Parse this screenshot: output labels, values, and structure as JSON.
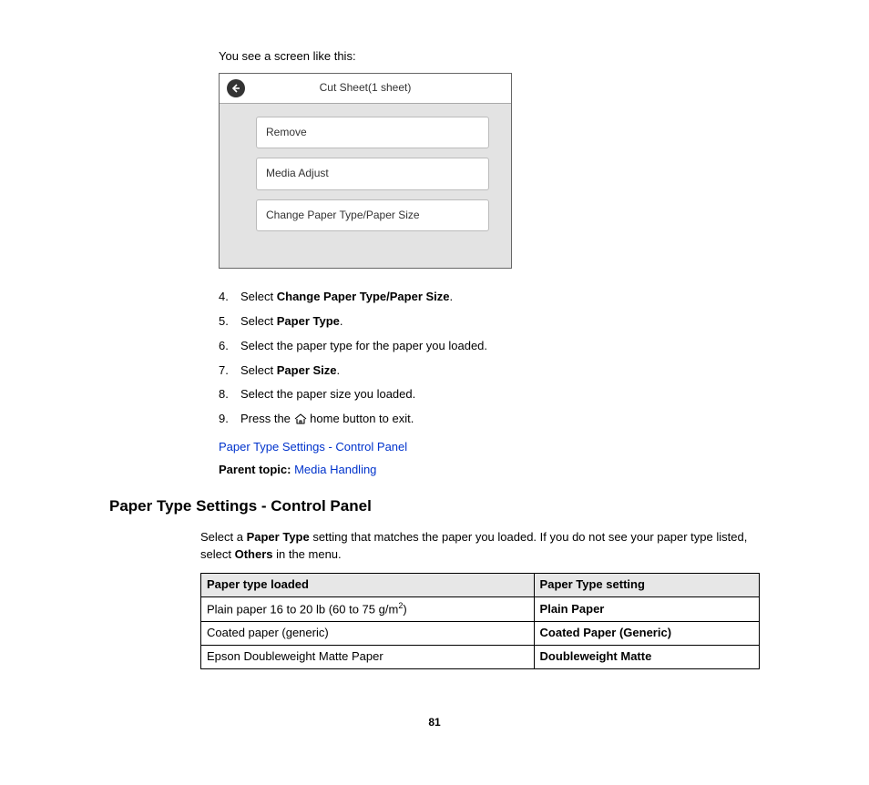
{
  "intro": "You see a screen like this:",
  "panel": {
    "title": "Cut Sheet(1 sheet)",
    "items": [
      "Remove",
      "Media Adjust",
      "Change Paper Type/Paper Size"
    ]
  },
  "steps": {
    "s4": {
      "num": "4.",
      "pre": "Select ",
      "bold": "Change Paper Type/Paper Size",
      "post": "."
    },
    "s5": {
      "num": "5.",
      "pre": "Select ",
      "bold": "Paper Type",
      "post": "."
    },
    "s6": {
      "num": "6.",
      "text": "Select the paper type for the paper you loaded."
    },
    "s7": {
      "num": "7.",
      "pre": "Select ",
      "bold": "Paper Size",
      "post": "."
    },
    "s8": {
      "num": "8.",
      "text": "Select the paper size you loaded."
    },
    "s9": {
      "num": "9.",
      "pre": "Press the ",
      "post": " home button to exit."
    }
  },
  "link1": "Paper Type Settings - Control Panel",
  "parent_label": "Parent topic: ",
  "parent_link": "Media Handling",
  "heading": "Paper Type Settings - Control Panel",
  "sect_desc_pre": "Select a ",
  "sect_desc_bold1": "Paper Type",
  "sect_desc_mid": " setting that matches the paper you loaded. If you do not see your paper type listed, select ",
  "sect_desc_bold2": "Others",
  "sect_desc_post": " in the menu.",
  "table": {
    "h1": "Paper type loaded",
    "h2": "Paper Type setting",
    "rows": [
      {
        "c1_pre": "Plain paper 16 to 20 lb (60 to 75 g/m",
        "c1_sup": "2",
        "c1_post": ")",
        "c2": "Plain Paper"
      },
      {
        "c1": "Coated paper (generic)",
        "c2": "Coated Paper (Generic)"
      },
      {
        "c1": "Epson Doubleweight Matte Paper",
        "c2": "Doubleweight Matte"
      }
    ]
  },
  "page_number": "81"
}
